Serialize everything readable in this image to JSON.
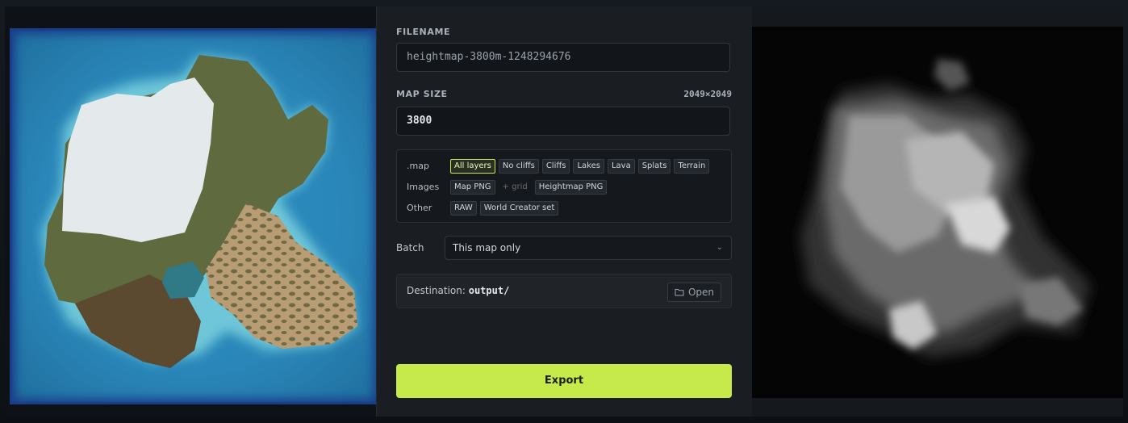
{
  "filename": {
    "label": "FILENAME",
    "value": "heightmap-3800m-1248294676"
  },
  "map_size": {
    "label": "MAP SIZE",
    "value": "3800",
    "resolution": "2049×2049"
  },
  "formats": {
    "map": {
      "label": ".map",
      "options": [
        "All layers",
        "No cliffs",
        "Cliffs",
        "Lakes",
        "Lava",
        "Splats",
        "Terrain"
      ],
      "selected": "All layers"
    },
    "images": {
      "label": "Images",
      "options": [
        "Map PNG",
        "+ grid",
        "Heightmap PNG"
      ]
    },
    "other": {
      "label": "Other",
      "options": [
        "RAW",
        "World Creator set"
      ]
    }
  },
  "batch": {
    "label": "Batch",
    "value": "This map only"
  },
  "destination": {
    "label": "Destination:",
    "value": "output/",
    "open_label": "Open"
  },
  "export_label": "Export",
  "colors": {
    "accent": "#c6ea4a",
    "ocean": "#2a86b8",
    "snow": "#e4e9ec",
    "grass": "#5f6a3f",
    "sand": "#b49a72",
    "dirt": "#5b4a30"
  },
  "icons": {
    "open": "folder-icon",
    "select": "chevron-down-icon"
  }
}
